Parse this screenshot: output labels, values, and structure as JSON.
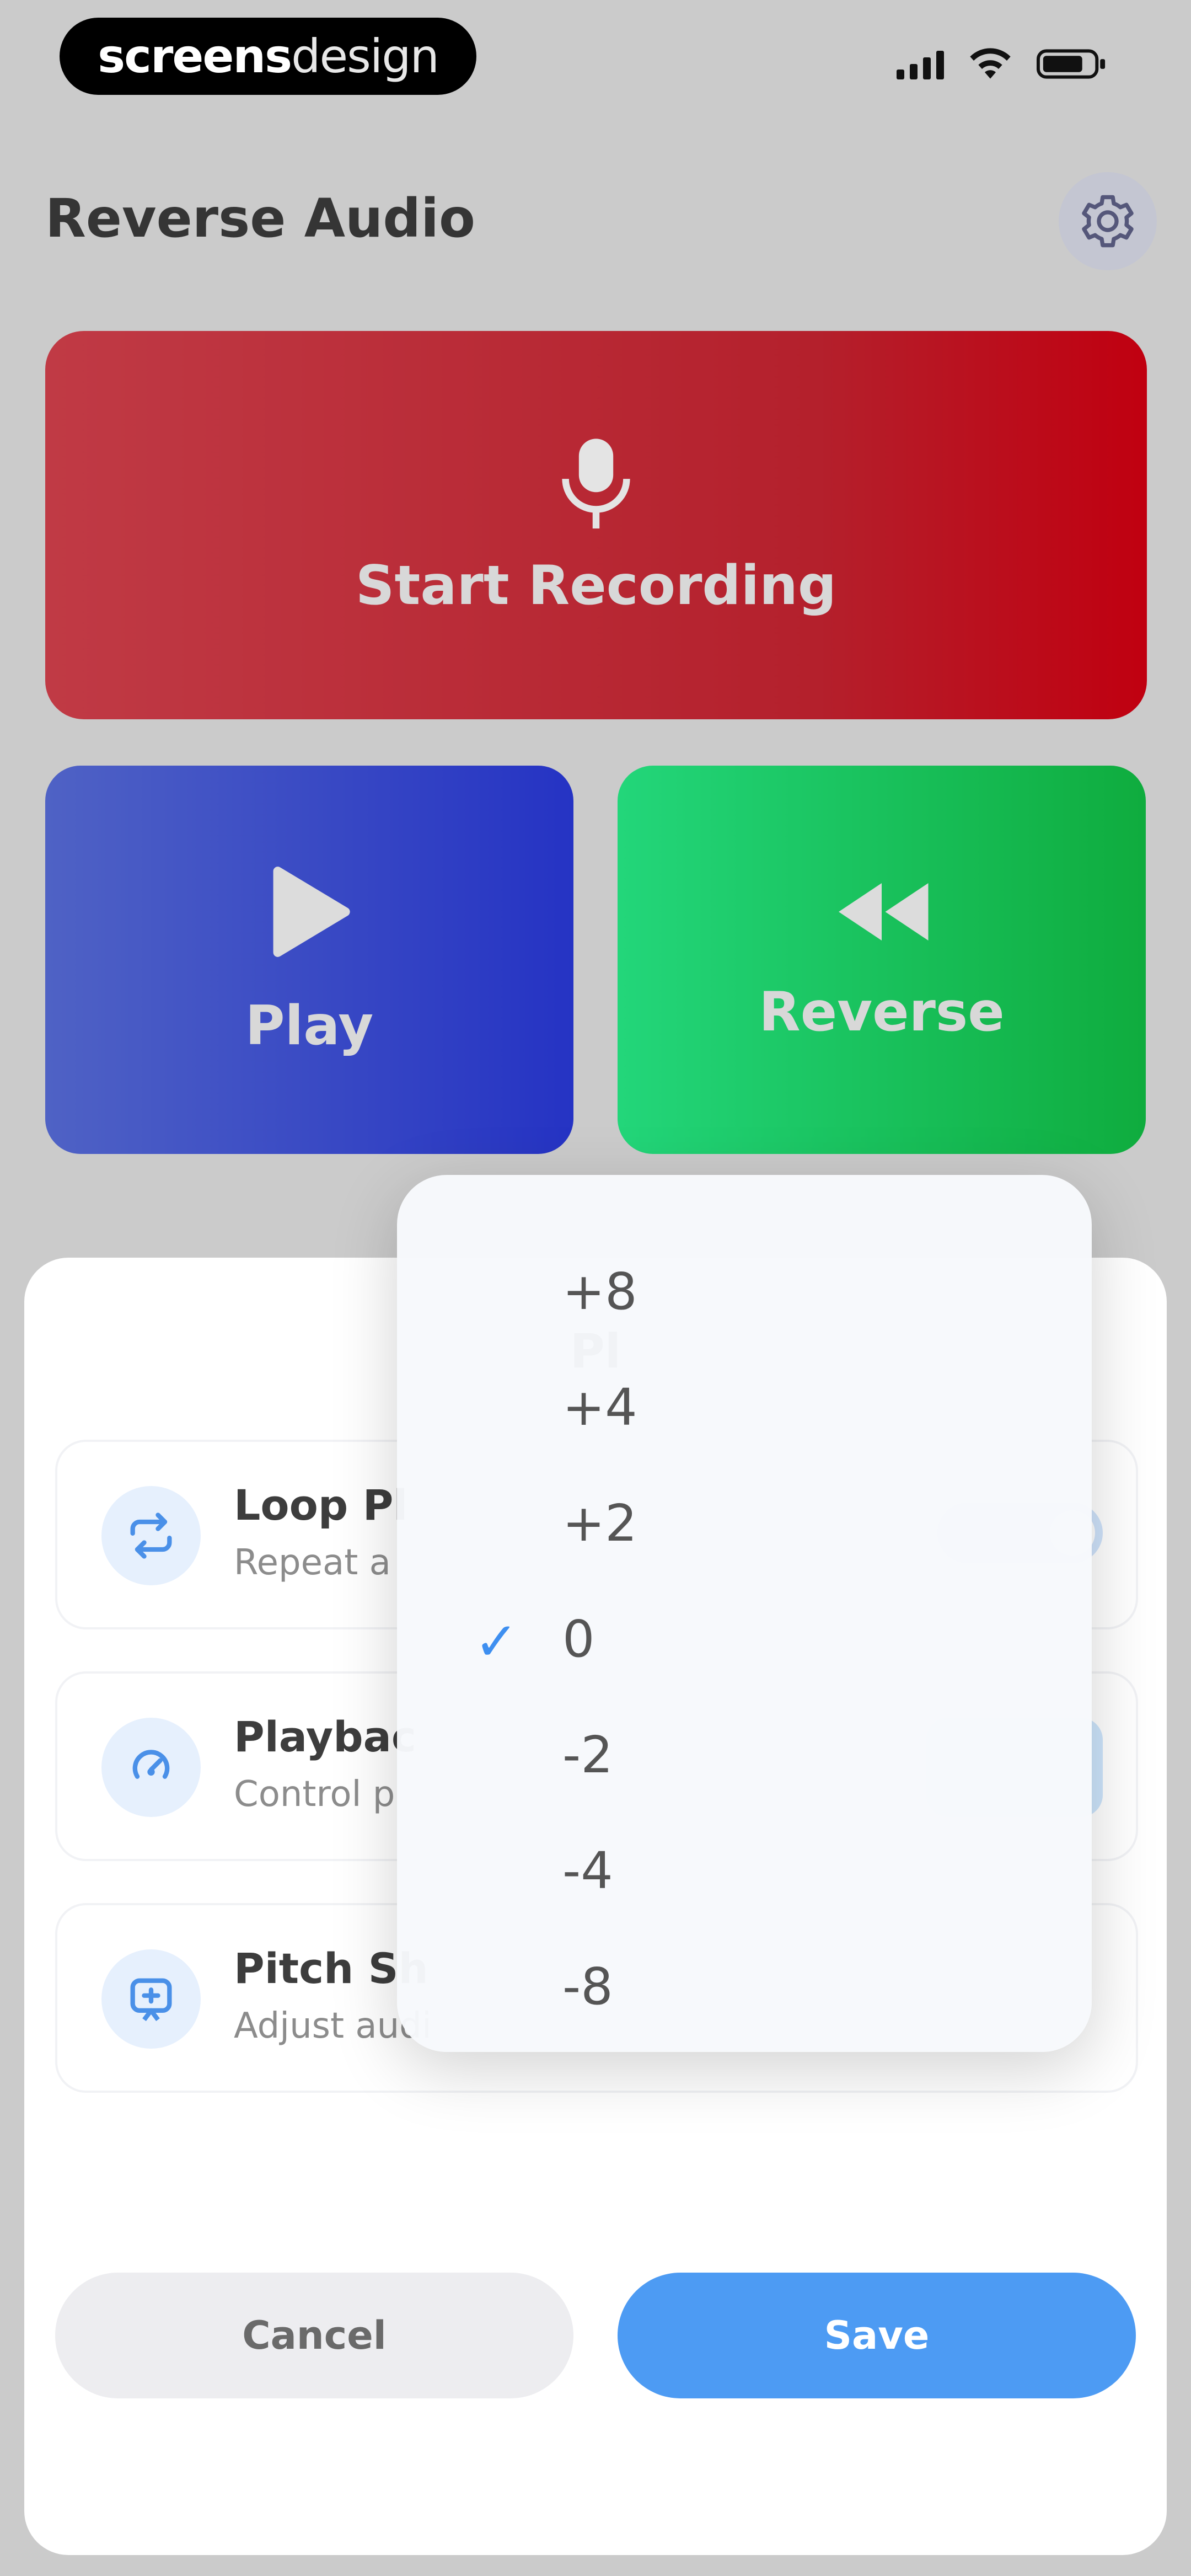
{
  "brand": {
    "bold": "screens",
    "thin": "design"
  },
  "header": {
    "title": "Reverse Audio"
  },
  "actions": {
    "record_label": "Start Recording",
    "play_label": "Play",
    "reverse_label": "Reverse"
  },
  "sheet": {
    "title": "Pl",
    "rows": [
      {
        "title": "Loop Pl",
        "subtitle": "Repeat a",
        "control": "toggle",
        "enabled": true
      },
      {
        "title": "Playbac",
        "subtitle": "Control p",
        "control": "speed"
      },
      {
        "title": "Pitch Sh",
        "subtitle": "Adjust audi"
      }
    ],
    "cancel_label": "Cancel",
    "save_label": "Save"
  },
  "pitch_dropdown": {
    "options": [
      "+8",
      "+4",
      "+2",
      "0",
      "-2",
      "-4",
      "-8"
    ],
    "selected": "0"
  },
  "colors": {
    "record": "#b4202c",
    "play": "#2533c4",
    "reverse": "#0fac3e",
    "accent": "#4d9bf3"
  },
  "icons": {
    "settings": "gear-icon",
    "record": "microphone-icon",
    "play": "play-icon",
    "reverse": "rewind-icon",
    "loop": "repeat-icon",
    "speed": "speed-icon",
    "pitch": "pitch-icon"
  }
}
